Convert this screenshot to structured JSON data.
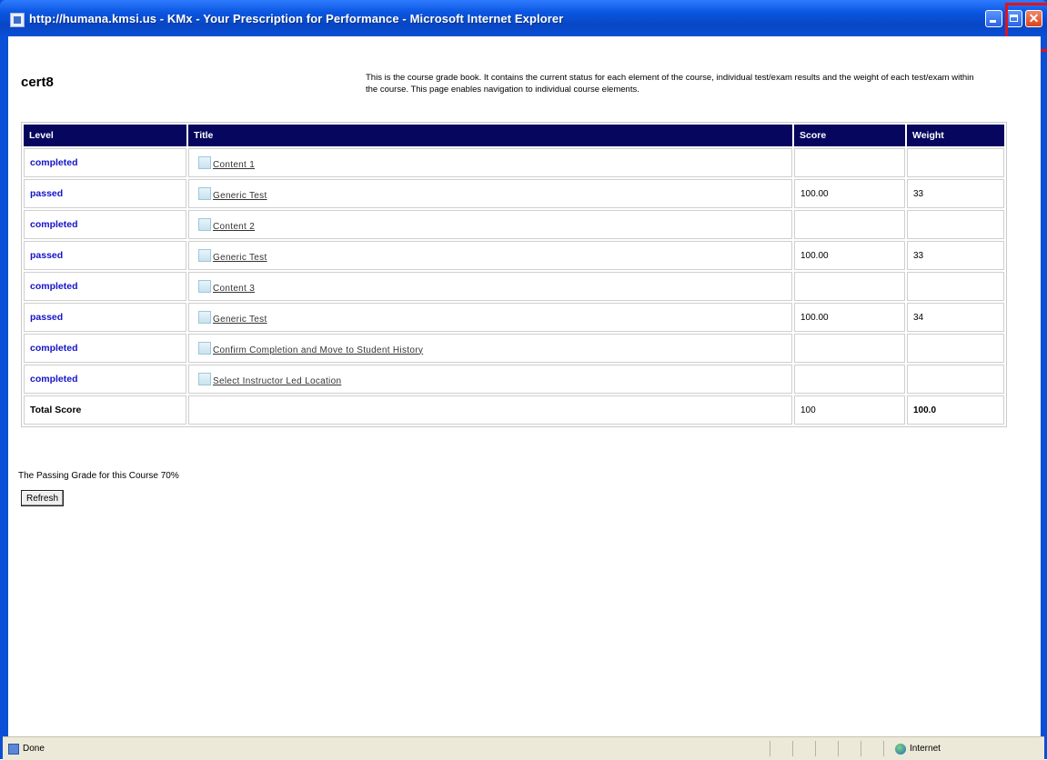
{
  "window": {
    "title": "http://humana.kmsi.us - KMx - Your Prescription for Performance - Microsoft Internet Explorer",
    "close_symbol": "✕"
  },
  "page": {
    "course_title": "cert8",
    "description": "This is the course grade book. It contains the current status for each element of the course, individual test/exam results and the weight of each test/exam within the course. This page enables navigation to individual course elements.",
    "columns": [
      "Level",
      "Title",
      "Score",
      "Weight"
    ],
    "rows": [
      {
        "level": "completed",
        "title": "Content 1",
        "score": "",
        "weight": ""
      },
      {
        "level": "passed",
        "title": "Generic Test",
        "score": "100.00",
        "weight": "33"
      },
      {
        "level": "completed",
        "title": "Content 2",
        "score": "",
        "weight": ""
      },
      {
        "level": "passed",
        "title": "Generic Test",
        "score": "100.00",
        "weight": "33"
      },
      {
        "level": "completed",
        "title": "Content 3",
        "score": "",
        "weight": ""
      },
      {
        "level": "passed",
        "title": "Generic Test",
        "score": "100.00",
        "weight": "34"
      },
      {
        "level": "completed",
        "title": "Confirm Completion and Move to Student History",
        "score": "",
        "weight": ""
      },
      {
        "level": "completed",
        "title": "Select Instructor Led Location",
        "score": "",
        "weight": ""
      }
    ],
    "total": {
      "label": "Total Score",
      "score": "100",
      "weight": "100.0"
    },
    "passing_grade_text": "The Passing Grade for this Course 70%",
    "refresh_label": "Refresh"
  },
  "statusbar": {
    "status_text": "Done",
    "zone_text": "Internet"
  },
  "colors": {
    "table_header_bg": "#06065f",
    "level_link": "#1414c8",
    "titlebar": "#0a4fd6",
    "highlight": "#e1131c"
  }
}
